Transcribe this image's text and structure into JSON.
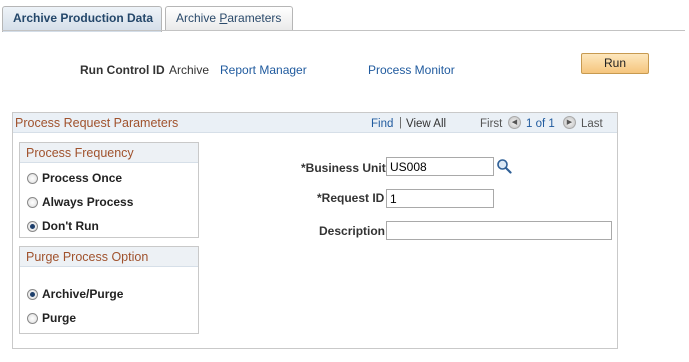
{
  "tabs": [
    {
      "label": "Archive Production Data",
      "active": true
    },
    {
      "label_prefix": "Archive ",
      "label_accel": "P",
      "label_suffix": "arameters",
      "active": false
    }
  ],
  "run_control": {
    "label": "Run Control ID",
    "value": "Archive",
    "report_manager": "Report Manager",
    "process_monitor": "Process Monitor",
    "run_button": "Run"
  },
  "process_request": {
    "title": "Process Request Parameters",
    "find": "Find",
    "separator": "|",
    "view_all": "View All",
    "first": "First",
    "count": "1 of 1",
    "last": "Last",
    "prev_arrow": "◀",
    "next_arrow": "▶"
  },
  "process_frequency": {
    "title": "Process Frequency",
    "options": [
      {
        "label": "Process Once",
        "selected": false
      },
      {
        "label": "Always Process",
        "selected": false
      },
      {
        "label": "Don't Run",
        "selected": true
      }
    ]
  },
  "purge_option": {
    "title": "Purge Process Option",
    "options": [
      {
        "label": "Archive/Purge",
        "selected": true
      },
      {
        "label": "Purge",
        "selected": false
      }
    ]
  },
  "fields": {
    "business_unit_label": "*Business Unit",
    "business_unit_value": "US008",
    "request_id_label": "*Request ID",
    "request_id_value": "1",
    "description_label": "Description",
    "description_value": ""
  },
  "icons": {
    "lookup": "magnifier-icon",
    "prev": "previous-arrow-icon",
    "next": "next-arrow-icon"
  },
  "colors": {
    "section_title": "#a0522d",
    "link": "#1f5a9e",
    "run_button": "#f5c57d"
  }
}
